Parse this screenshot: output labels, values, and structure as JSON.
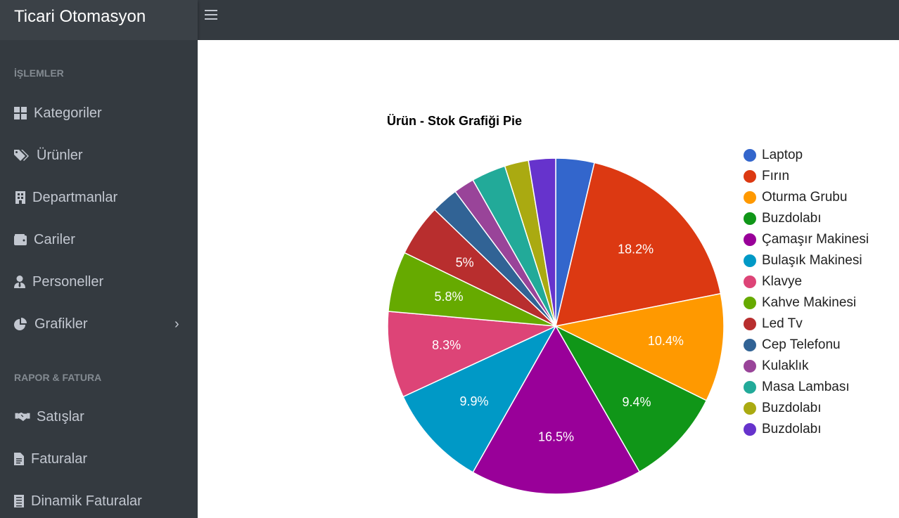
{
  "app": {
    "title": "Ticari Otomasyon"
  },
  "sidebar": {
    "section1": "İŞLEMLER",
    "items1": [
      {
        "label": "Kategoriler",
        "icon": "th-large-icon"
      },
      {
        "label": "Ürünler",
        "icon": "tags-icon"
      },
      {
        "label": "Departmanlar",
        "icon": "building-icon"
      },
      {
        "label": "Cariler",
        "icon": "wallet-icon"
      },
      {
        "label": "Personeller",
        "icon": "user-tie-icon"
      },
      {
        "label": "Grafikler",
        "icon": "pie-chart-icon"
      }
    ],
    "section2": "RAPOR & FATURA",
    "items2": [
      {
        "label": "Satışlar",
        "icon": "handshake-icon"
      },
      {
        "label": "Faturalar",
        "icon": "file-invoice-icon"
      },
      {
        "label": "Dinamik Faturalar",
        "icon": "file-list-icon"
      }
    ]
  },
  "chart_data": {
    "type": "pie",
    "title": "Ürün - Stok Grafiği Pie",
    "legend_position": "right",
    "slices": [
      {
        "name": "Laptop",
        "value": 3.7,
        "label": "",
        "color": "#3366cc"
      },
      {
        "name": "Fırın",
        "value": 18.2,
        "label": "18.2%",
        "color": "#dc3912"
      },
      {
        "name": "Oturma Grubu",
        "value": 10.4,
        "label": "10.4%",
        "color": "#ff9900"
      },
      {
        "name": "Buzdolabı",
        "value": 9.4,
        "label": "9.4%",
        "color": "#109618"
      },
      {
        "name": "Çamaşır Makinesi",
        "value": 16.5,
        "label": "16.5%",
        "color": "#990099"
      },
      {
        "name": "Bulaşık Makinesi",
        "value": 9.9,
        "label": "9.9%",
        "color": "#0099c6"
      },
      {
        "name": "Klavye",
        "value": 8.3,
        "label": "8.3%",
        "color": "#dd4477"
      },
      {
        "name": "Kahve Makinesi",
        "value": 5.8,
        "label": "5.8%",
        "color": "#66aa00"
      },
      {
        "name": "Led Tv",
        "value": 5.0,
        "label": "5%",
        "color": "#b82e2e"
      },
      {
        "name": "Cep Telefonu",
        "value": 2.6,
        "label": "",
        "color": "#316395"
      },
      {
        "name": "Kulaklık",
        "value": 2.0,
        "label": "",
        "color": "#994499"
      },
      {
        "name": "Masa Lambası",
        "value": 3.3,
        "label": "",
        "color": "#22aa99"
      },
      {
        "name": "Buzdolabı",
        "value": 2.3,
        "label": "",
        "color": "#aaaa11"
      },
      {
        "name": "Buzdolabı",
        "value": 2.6,
        "label": "",
        "color": "#6633cc"
      }
    ]
  }
}
